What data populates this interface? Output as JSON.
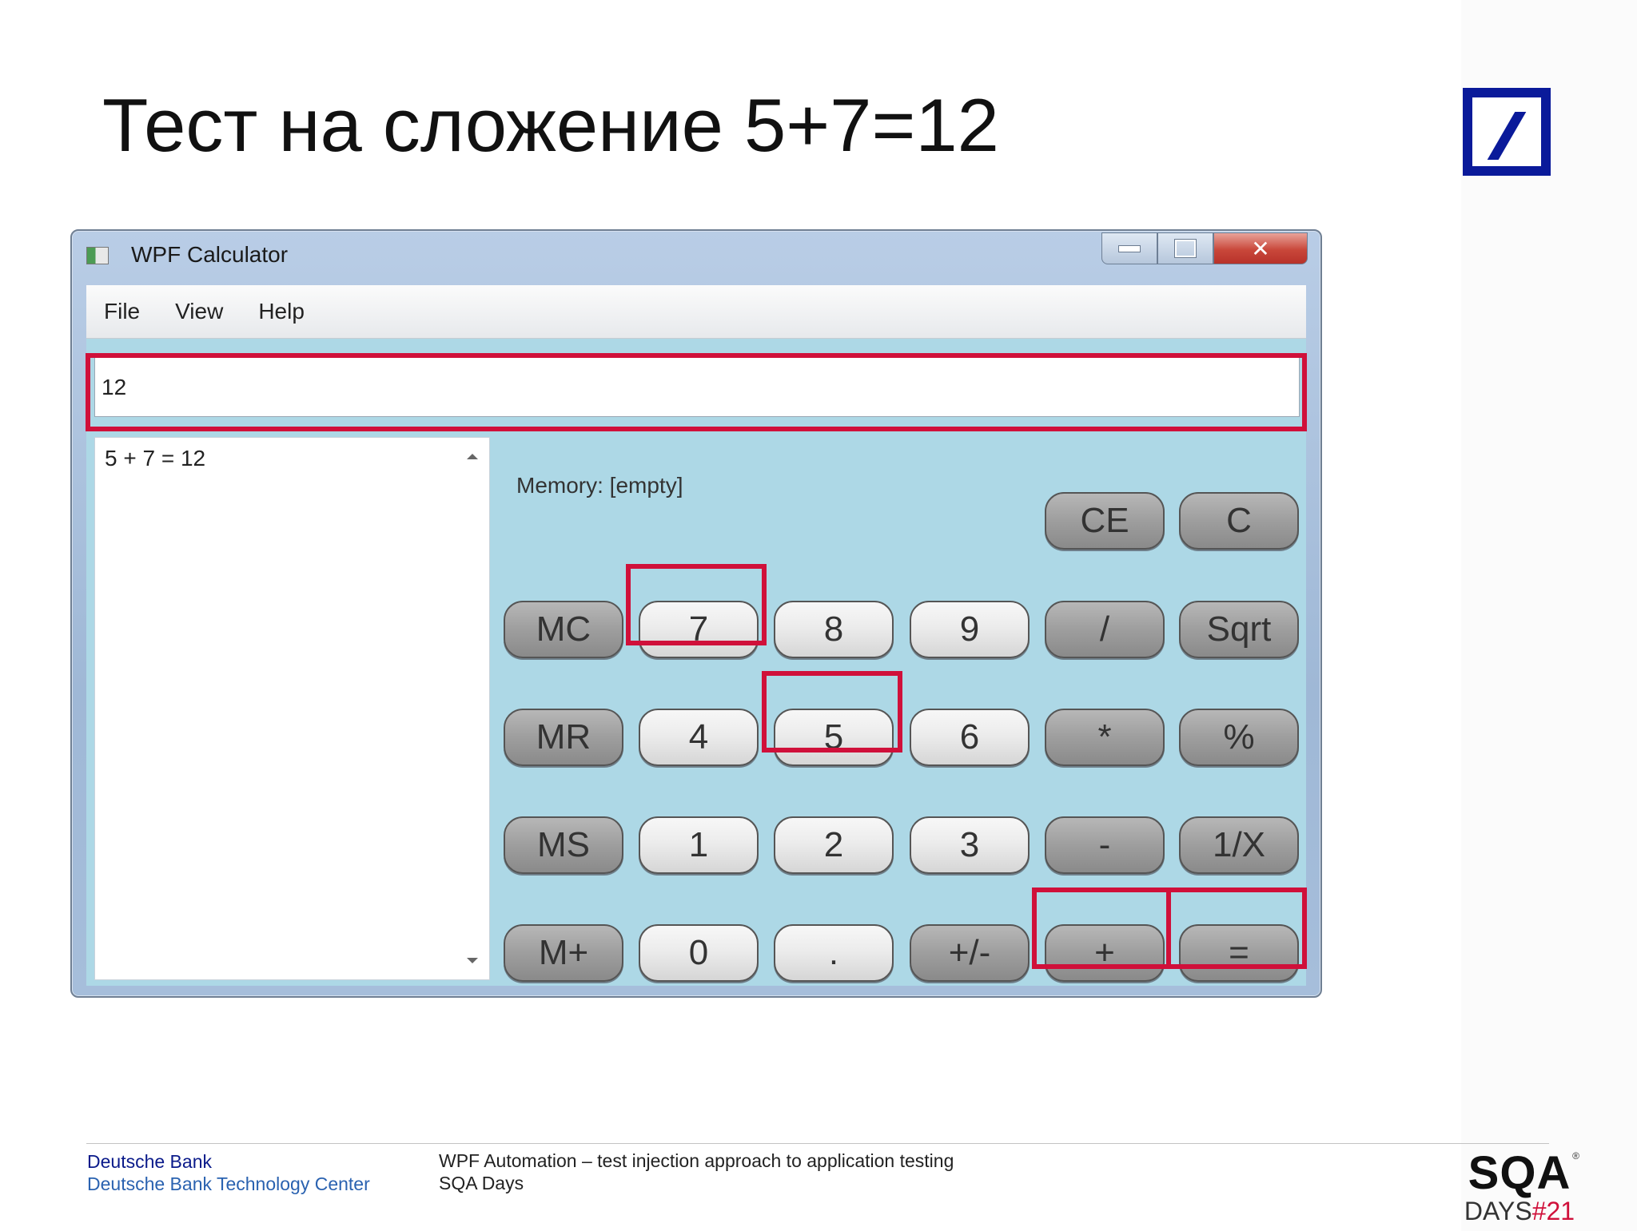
{
  "slide": {
    "title": "Тест на сложение 5+7=12"
  },
  "window": {
    "title": "WPF Calculator",
    "controls": {
      "close": "✕"
    },
    "menu": [
      "File",
      "View",
      "Help"
    ],
    "display_value": "12",
    "history": [
      "5 + 7 = 12"
    ],
    "memory_label": "Memory: [empty]"
  },
  "keys": {
    "ce": "CE",
    "c": "C",
    "mc": "MC",
    "k7": "7",
    "k8": "8",
    "k9": "9",
    "div": "/",
    "sqrt": "Sqrt",
    "mr": "MR",
    "k4": "4",
    "k5": "5",
    "k6": "6",
    "mul": "*",
    "pct": "%",
    "ms": "MS",
    "k1": "1",
    "k2": "2",
    "k3": "3",
    "sub": "-",
    "inv": "1/X",
    "mplus": "M+",
    "k0": "0",
    "dot": ".",
    "neg": "+/-",
    "add": "+",
    "eq": "="
  },
  "highlight_color": "#d0103a",
  "footer": {
    "org_line1": "Deutsche Bank",
    "org_line2": "Deutsche Bank Technology Center",
    "talk_line1": "WPF Automation – test injection approach to application testing",
    "talk_line2": "SQA Days",
    "logo_main": "SQA",
    "logo_sub": "DAYS",
    "logo_num": "#21",
    "logo_reg": "®"
  }
}
